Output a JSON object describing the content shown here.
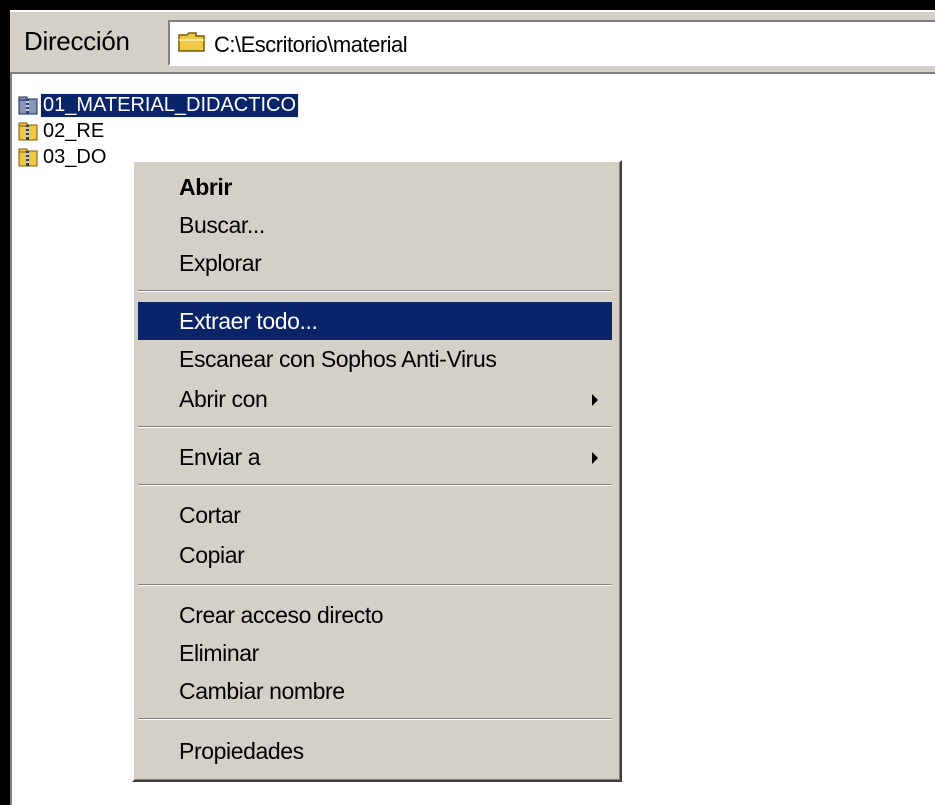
{
  "address_bar": {
    "label": "Dirección",
    "path": "C:\\Escritorio\\material",
    "icon": "folder-icon"
  },
  "files": [
    {
      "name": "01_MATERIAL_DIDACTICO",
      "icon": "zip-folder-icon",
      "selected": true
    },
    {
      "name": "02_RE",
      "icon": "zip-folder-icon",
      "selected": false
    },
    {
      "name": "03_DO",
      "icon": "zip-folder-icon",
      "selected": false
    }
  ],
  "context_menu": {
    "items": {
      "open": "Abrir",
      "search": "Buscar...",
      "explore": "Explorar",
      "extract_all": "Extraer todo...",
      "scan": "Escanear con Sophos Anti-Virus",
      "open_with": "Abrir con",
      "send_to": "Enviar a",
      "cut": "Cortar",
      "copy": "Copiar",
      "create_shortcut": "Crear acceso directo",
      "delete": "Eliminar",
      "rename": "Cambiar nombre",
      "properties": "Propiedades"
    },
    "highlighted_item": "Extraer todo..."
  },
  "colors": {
    "face": "#d4d0c8",
    "highlight": "#0a246a",
    "folder": "#f0c848"
  }
}
